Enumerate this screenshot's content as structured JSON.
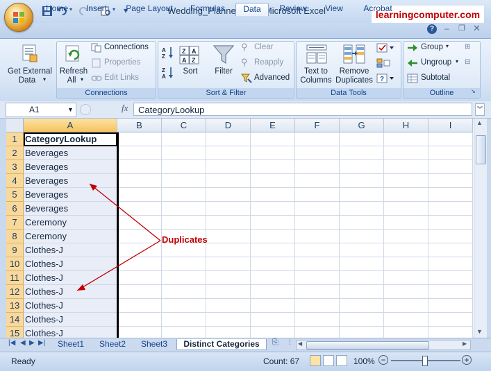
{
  "window": {
    "title": "Wedding_Planner.xlsx - Microsoft Excel",
    "brand": "learningcomputer.com"
  },
  "tabs": [
    "Home",
    "Insert",
    "Page Layout",
    "Formulas",
    "Data",
    "Review",
    "View",
    "Acrobat"
  ],
  "active_tab": "Data",
  "ribbon": {
    "get_external_data": {
      "line1": "Get External",
      "line2": "Data"
    },
    "refresh_all": {
      "line1": "Refresh",
      "line2": "All"
    },
    "connections": "Connections",
    "properties": "Properties",
    "edit_links": "Edit Links",
    "connections_group": "Connections",
    "sort": "Sort",
    "filter": "Filter",
    "clear": "Clear",
    "reapply": "Reapply",
    "advanced": "Advanced",
    "sort_filter_group": "Sort & Filter",
    "text_to_columns": {
      "line1": "Text to",
      "line2": "Columns"
    },
    "remove_duplicates": {
      "line1": "Remove",
      "line2": "Duplicates"
    },
    "data_tools_group": "Data Tools",
    "group": "Group",
    "ungroup": "Ungroup",
    "subtotal": "Subtotal",
    "outline_group": "Outline"
  },
  "formula_bar": {
    "name_box": "A1",
    "fx": "fx",
    "formula": "CategoryLookup"
  },
  "grid": {
    "columns": [
      "A",
      "B",
      "C",
      "D",
      "E",
      "F",
      "G",
      "H",
      "I"
    ],
    "rows": [
      {
        "num": "1",
        "a": "CategoryLookup"
      },
      {
        "num": "2",
        "a": "Beverages"
      },
      {
        "num": "3",
        "a": "Beverages"
      },
      {
        "num": "4",
        "a": "Beverages"
      },
      {
        "num": "5",
        "a": "Beverages"
      },
      {
        "num": "6",
        "a": "Beverages"
      },
      {
        "num": "7",
        "a": "Ceremony"
      },
      {
        "num": "8",
        "a": "Ceremony"
      },
      {
        "num": "9",
        "a": "Clothes-J"
      },
      {
        "num": "10",
        "a": "Clothes-J"
      },
      {
        "num": "11",
        "a": "Clothes-J"
      },
      {
        "num": "12",
        "a": "Clothes-J"
      },
      {
        "num": "13",
        "a": "Clothes-J"
      },
      {
        "num": "14",
        "a": "Clothes-J"
      },
      {
        "num": "15",
        "a": "Clothes-J"
      }
    ]
  },
  "annotation": "Duplicates",
  "sheets": [
    "Sheet1",
    "Sheet2",
    "Sheet3",
    "Distinct Categories"
  ],
  "active_sheet": "Distinct Categories",
  "status": {
    "ready": "Ready",
    "count": "Count: 67",
    "zoom": "100%"
  },
  "colors": {
    "accent": "#15428b",
    "annotation": "#c00000",
    "row_header": "#f9d99b"
  }
}
